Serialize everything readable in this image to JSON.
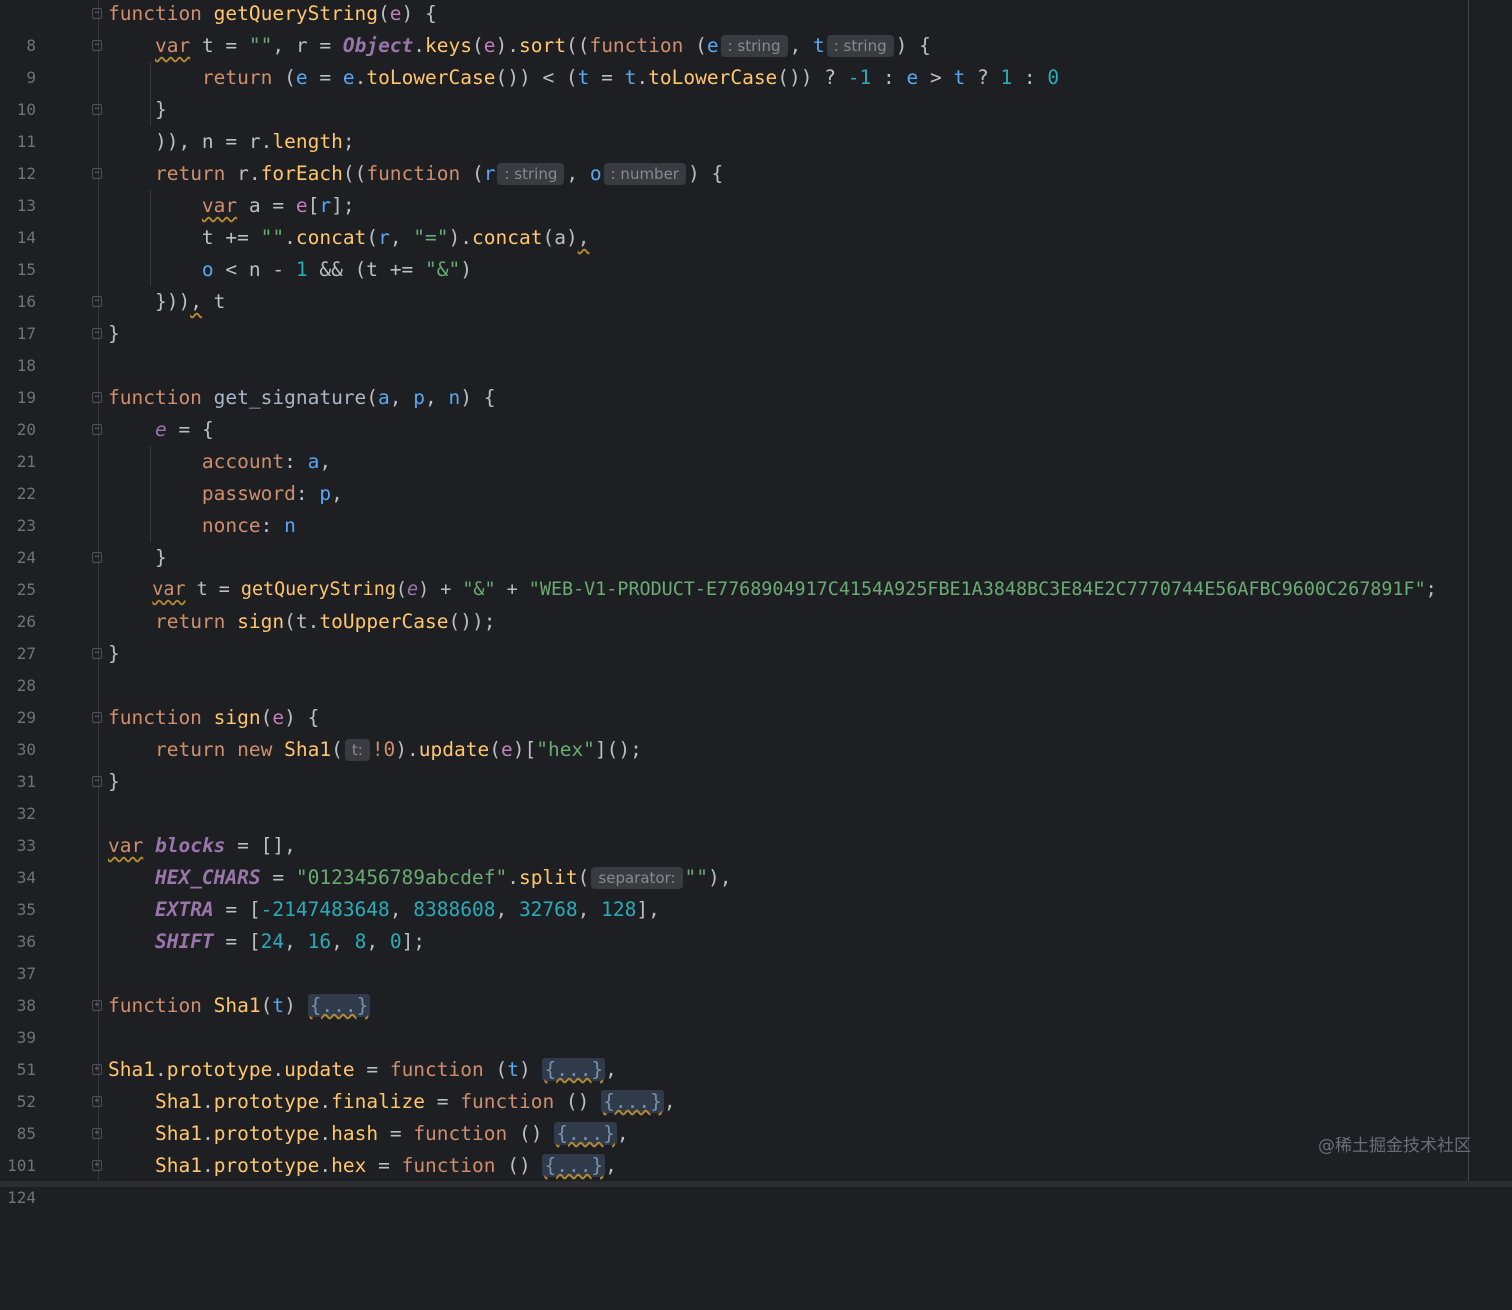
{
  "editor": {
    "lines": [
      {
        "num": "8",
        "text": "function getQueryString(e) {"
      },
      {
        "num": "9",
        "text": "var t = \"\", r = Object.keys(e).sort((function (e : string , t : string ) {"
      },
      {
        "num": "10",
        "text": "return (e = e.toLowerCase()) < (t = t.toLowerCase()) ? -1 : e > t ? 1 : 0"
      },
      {
        "num": "11",
        "text": "}"
      },
      {
        "num": "12",
        "text": ")), n = r.length;"
      },
      {
        "num": "13",
        "text": "return r.forEach((function (r : string , o : number ) {"
      },
      {
        "num": "14",
        "text": "var a = e[r];"
      },
      {
        "num": "15",
        "text": "t += \"\".concat(r, \"=\").concat(a),"
      },
      {
        "num": "16",
        "text": "o < n - 1 && (t += \"&\")"
      },
      {
        "num": "17",
        "text": "})), t"
      },
      {
        "num": "18",
        "text": "}"
      },
      {
        "num": "19",
        "text": ""
      },
      {
        "num": "20",
        "text": "function get_signature(a, p, n) {"
      },
      {
        "num": "21",
        "text": "e = {"
      },
      {
        "num": "22",
        "text": "account: a,"
      },
      {
        "num": "23",
        "text": "password: p,"
      },
      {
        "num": "24",
        "text": "nonce: n"
      },
      {
        "num": "25",
        "text": "}"
      },
      {
        "num": "26",
        "text": "var t = getQueryString(e) + \"&\" + \"WEB-V1-PRODUCT-E7768904917C4154A925FBE1A3848BC3E84E2C7770744E56AFBC9600C267891F\";"
      },
      {
        "num": "27",
        "text": "return sign(t.toUpperCase());"
      },
      {
        "num": "28",
        "text": "}"
      },
      {
        "num": "29",
        "text": ""
      },
      {
        "num": "30",
        "text": "function sign(e) {"
      },
      {
        "num": "31",
        "text": "return new Sha1( t: !0).update(e)[\"hex\"]();"
      },
      {
        "num": "32",
        "text": "}"
      },
      {
        "num": "33",
        "text": ""
      },
      {
        "num": "34",
        "text": "var blocks = [],"
      },
      {
        "num": "35",
        "text": "HEX_CHARS = \"0123456789abcdef\".split( separator: \"\"),"
      },
      {
        "num": "36",
        "text": "EXTRA = [-2147483648, 8388608, 32768, 128],"
      },
      {
        "num": "37",
        "text": "SHIFT = [24, 16, 8, 0];"
      },
      {
        "num": "38",
        "text": ""
      },
      {
        "num": "39",
        "text": "function Sha1(t) {...}"
      },
      {
        "num": "51",
        "text": ""
      },
      {
        "num": "52",
        "text": "Sha1.prototype.update = function (t) {...},"
      },
      {
        "num": "85",
        "text": "Sha1.prototype.finalize = function () {...},"
      },
      {
        "num": "101",
        "text": "Sha1.prototype.hash = function () {...},"
      },
      {
        "num": "124",
        "text": "Sha1.prototype.hex = function () {...},"
      }
    ],
    "hints": {
      "string": ": string",
      "number": ": number",
      "t": "t:",
      "separator": "separator:"
    },
    "colors": {
      "background": "#1e1f22",
      "keyword": "#cf8e6d",
      "function_name": "#56a8f5",
      "string": "#6aab73",
      "number": "#2aacb8",
      "global": "#9876aa",
      "text": "#bcbec4",
      "line_number": "#6f737a"
    }
  },
  "watermark": "@稀土掘金技术社区"
}
